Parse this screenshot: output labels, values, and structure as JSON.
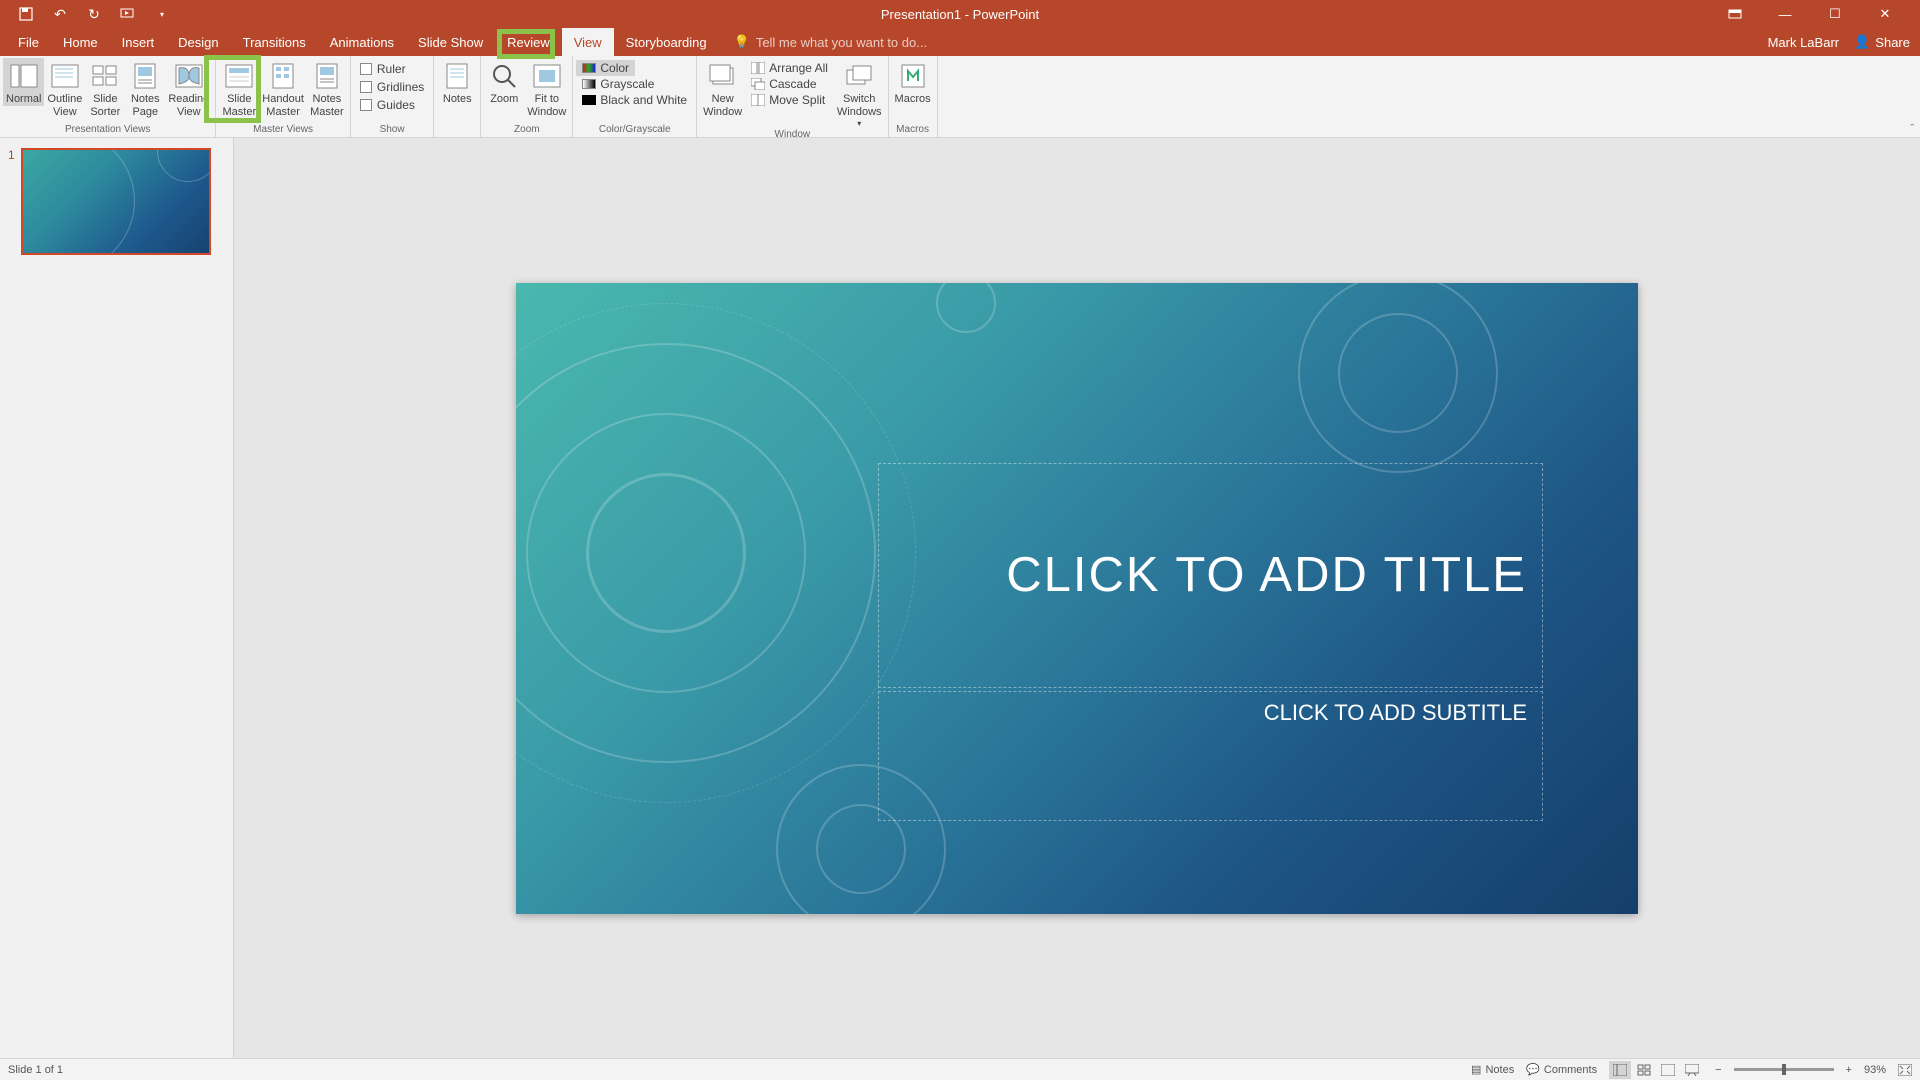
{
  "title": "Presentation1 - PowerPoint",
  "user": "Mark LaBarr",
  "share": "Share",
  "tabs": [
    "File",
    "Home",
    "Insert",
    "Design",
    "Transitions",
    "Animations",
    "Slide Show",
    "Review",
    "View",
    "Storyboarding"
  ],
  "active_tab": "View",
  "tellme_placeholder": "Tell me what you want to do...",
  "ribbon": {
    "presentation_views": {
      "label": "Presentation Views",
      "normal": "Normal",
      "outline": "Outline\nView",
      "sorter": "Slide\nSorter",
      "notes_page": "Notes\nPage",
      "reading": "Reading\nView"
    },
    "master_views": {
      "label": "Master Views",
      "slide_master": "Slide\nMaster",
      "handout_master": "Handout\nMaster",
      "notes_master": "Notes\nMaster"
    },
    "show": {
      "label": "Show",
      "ruler": "Ruler",
      "gridlines": "Gridlines",
      "guides": "Guides"
    },
    "notes": "Notes",
    "zoom": {
      "label": "Zoom",
      "zoom": "Zoom",
      "fit": "Fit to\nWindow"
    },
    "color": {
      "label": "Color/Grayscale",
      "color": "Color",
      "grayscale": "Grayscale",
      "bw": "Black and White"
    },
    "window": {
      "label": "Window",
      "new": "New\nWindow",
      "arrange": "Arrange All",
      "cascade": "Cascade",
      "move_split": "Move Split",
      "switch": "Switch\nWindows"
    },
    "macros": {
      "label": "Macros",
      "macros": "Macros"
    }
  },
  "thumb_number": "1",
  "slide": {
    "title_placeholder": "CLICK TO ADD TITLE",
    "subtitle_placeholder": "CLICK TO ADD SUBTITLE"
  },
  "status": {
    "slide_info": "Slide 1 of 1",
    "notes": "Notes",
    "comments": "Comments",
    "zoom": "93%"
  }
}
